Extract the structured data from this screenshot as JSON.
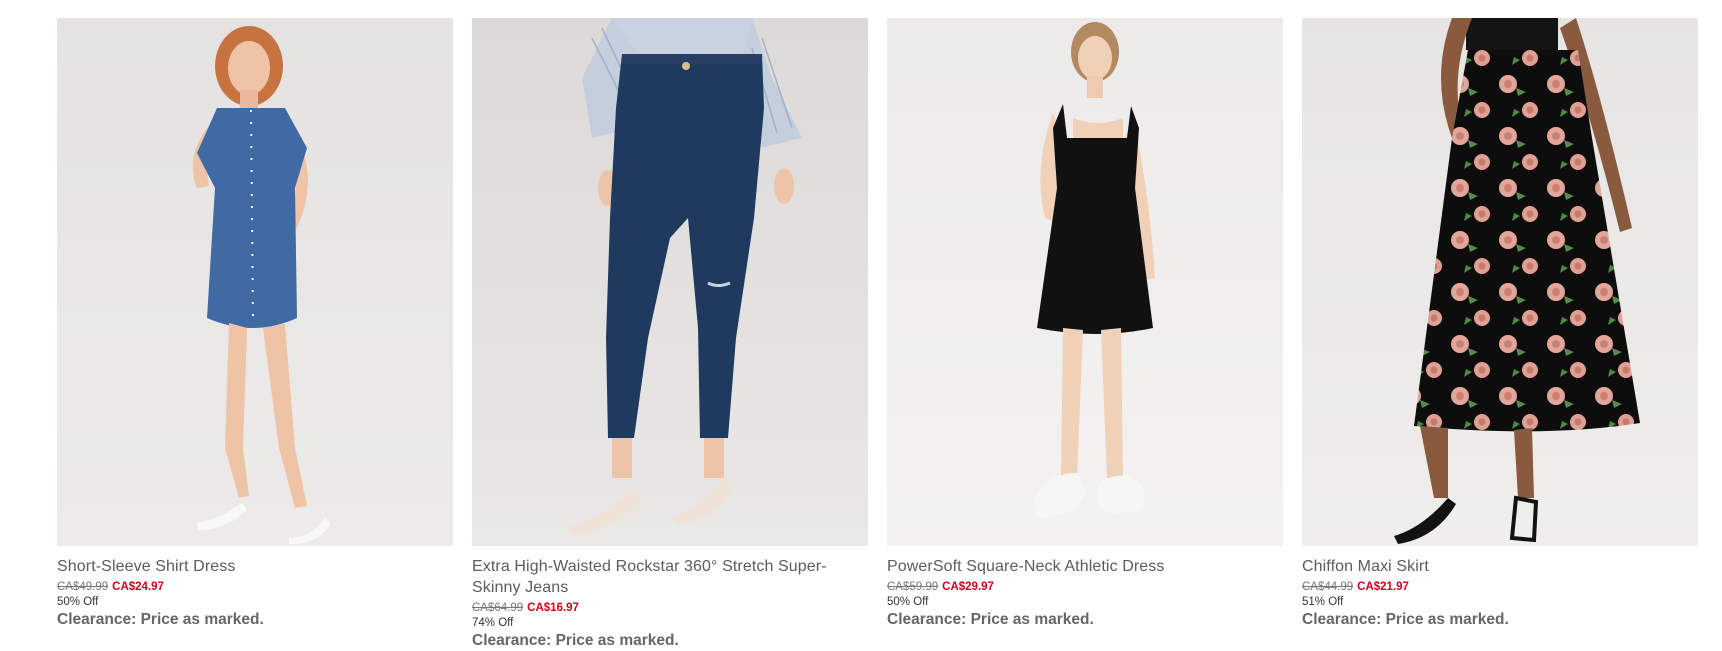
{
  "products": [
    {
      "image_icon": "denim-shirt-dress-photo",
      "title": "Short-Sleeve Shirt Dress",
      "original_price": "CA$49.99",
      "sale_price": "CA$24.97",
      "discount": "50% Off",
      "note": "Clearance: Price as marked."
    },
    {
      "image_icon": "skinny-jeans-photo",
      "title": "Extra High-Waisted Rockstar 360° Stretch Super-Skinny Jeans",
      "original_price": "CA$64.99",
      "sale_price": "CA$16.97",
      "discount": "74% Off",
      "note": "Clearance: Price as marked."
    },
    {
      "image_icon": "black-athletic-dress-photo",
      "title": "PowerSoft Square-Neck Athletic Dress",
      "original_price": "CA$59.99",
      "sale_price": "CA$29.97",
      "discount": "50% Off",
      "note": "Clearance: Price as marked."
    },
    {
      "image_icon": "floral-maxi-skirt-photo",
      "title": "Chiffon Maxi Skirt",
      "original_price": "CA$44.99",
      "sale_price": "CA$21.97",
      "discount": "51% Off",
      "note": "Clearance: Price as marked."
    }
  ],
  "colors": {
    "sale_price": "#d0021b",
    "title_text": "#5c5c5c",
    "photo_background": "#e6e5e3"
  }
}
